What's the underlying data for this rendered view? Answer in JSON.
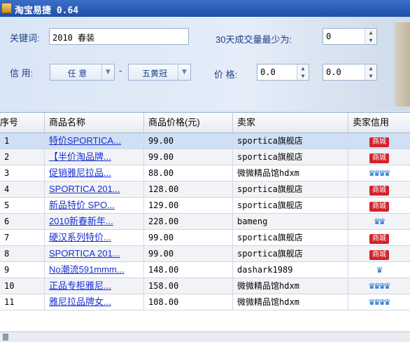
{
  "window": {
    "title": "淘宝易捷 0.64"
  },
  "search": {
    "keyword_label": "关键词:",
    "keyword_value": "2010 春装",
    "min_volume_label": "30天成交量最少为:",
    "min_volume_value": "0",
    "credit_label": "信 用:",
    "credit_from": "任 意",
    "credit_dash": "-",
    "credit_to": "五黄冠",
    "price_label": "价 格:",
    "price_min": "0.0",
    "price_max": "0.0"
  },
  "table": {
    "columns": [
      "序号",
      "商品名称",
      "商品价格(元)",
      "卖家",
      "卖家信用"
    ],
    "rows": [
      {
        "no": "1",
        "name": "特价SPORTICA...",
        "price": "99.00",
        "seller": "sportica旗舰店",
        "credit": "商城"
      },
      {
        "no": "2",
        "name": "【半价淘品牌...",
        "price": "99.00",
        "seller": "sportica旗舰店",
        "credit": "商城"
      },
      {
        "no": "3",
        "name": "促销雅尼拉品...",
        "price": "88.00",
        "seller": "微微精品馆hdxm",
        "credit": "crowns4"
      },
      {
        "no": "4",
        "name": "SPORTICA 201...",
        "price": "128.00",
        "seller": "sportica旗舰店",
        "credit": "商城"
      },
      {
        "no": "5",
        "name": "新品特价 SPO...",
        "price": "129.00",
        "seller": "sportica旗舰店",
        "credit": "商城"
      },
      {
        "no": "6",
        "name": "2010新春新年...",
        "price": "228.00",
        "seller": "bameng",
        "credit": "crowns2"
      },
      {
        "no": "7",
        "name": "硬汉系列特价...",
        "price": "99.00",
        "seller": "sportica旗舰店",
        "credit": "商城"
      },
      {
        "no": "8",
        "name": "SPORTICA 201...",
        "price": "99.00",
        "seller": "sportica旗舰店",
        "credit": "商城"
      },
      {
        "no": "9",
        "name": "No潮流591mmm...",
        "price": "148.00",
        "seller": "dashark1989",
        "credit": "crowns1"
      },
      {
        "no": "10",
        "name": "正品专柜雅尼...",
        "price": "158.00",
        "seller": "微微精品馆hdxm",
        "credit": "crowns4"
      },
      {
        "no": "11",
        "name": "雅尼拉品牌女...",
        "price": "108.00",
        "seller": "微微精品馆hdxm",
        "credit": "crowns4"
      }
    ]
  }
}
